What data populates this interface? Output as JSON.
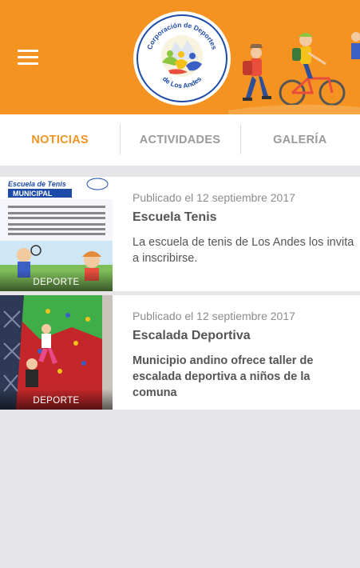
{
  "header": {
    "menu_icon": "hamburger-menu-icon",
    "logo_text_top": "Corporación de Deportes",
    "logo_text_bottom": "de Los Andes",
    "brand_color": "#f49322"
  },
  "tabs": [
    {
      "label": "NOTICIAS",
      "active": true
    },
    {
      "label": "ACTIVIDADES",
      "active": false
    },
    {
      "label": "GALERÍA",
      "active": false
    }
  ],
  "news": [
    {
      "date": "Publicado el 12 septiembre 2017",
      "title": "Escuela Tenis",
      "description": " La escuela de tenis de Los Andes los invita a inscribirse.",
      "category": "DEPORTE",
      "thumb_heading_line1": "Escuela de Tenis",
      "thumb_heading_line2": "MUNICIPAL"
    },
    {
      "date": "Publicado el 12 septiembre 2017",
      "title": "Escalada Deportiva",
      "description": "Municipio andino ofrece taller de escalada deportiva a niños de la comuna",
      "category": "DEPORTE"
    }
  ]
}
